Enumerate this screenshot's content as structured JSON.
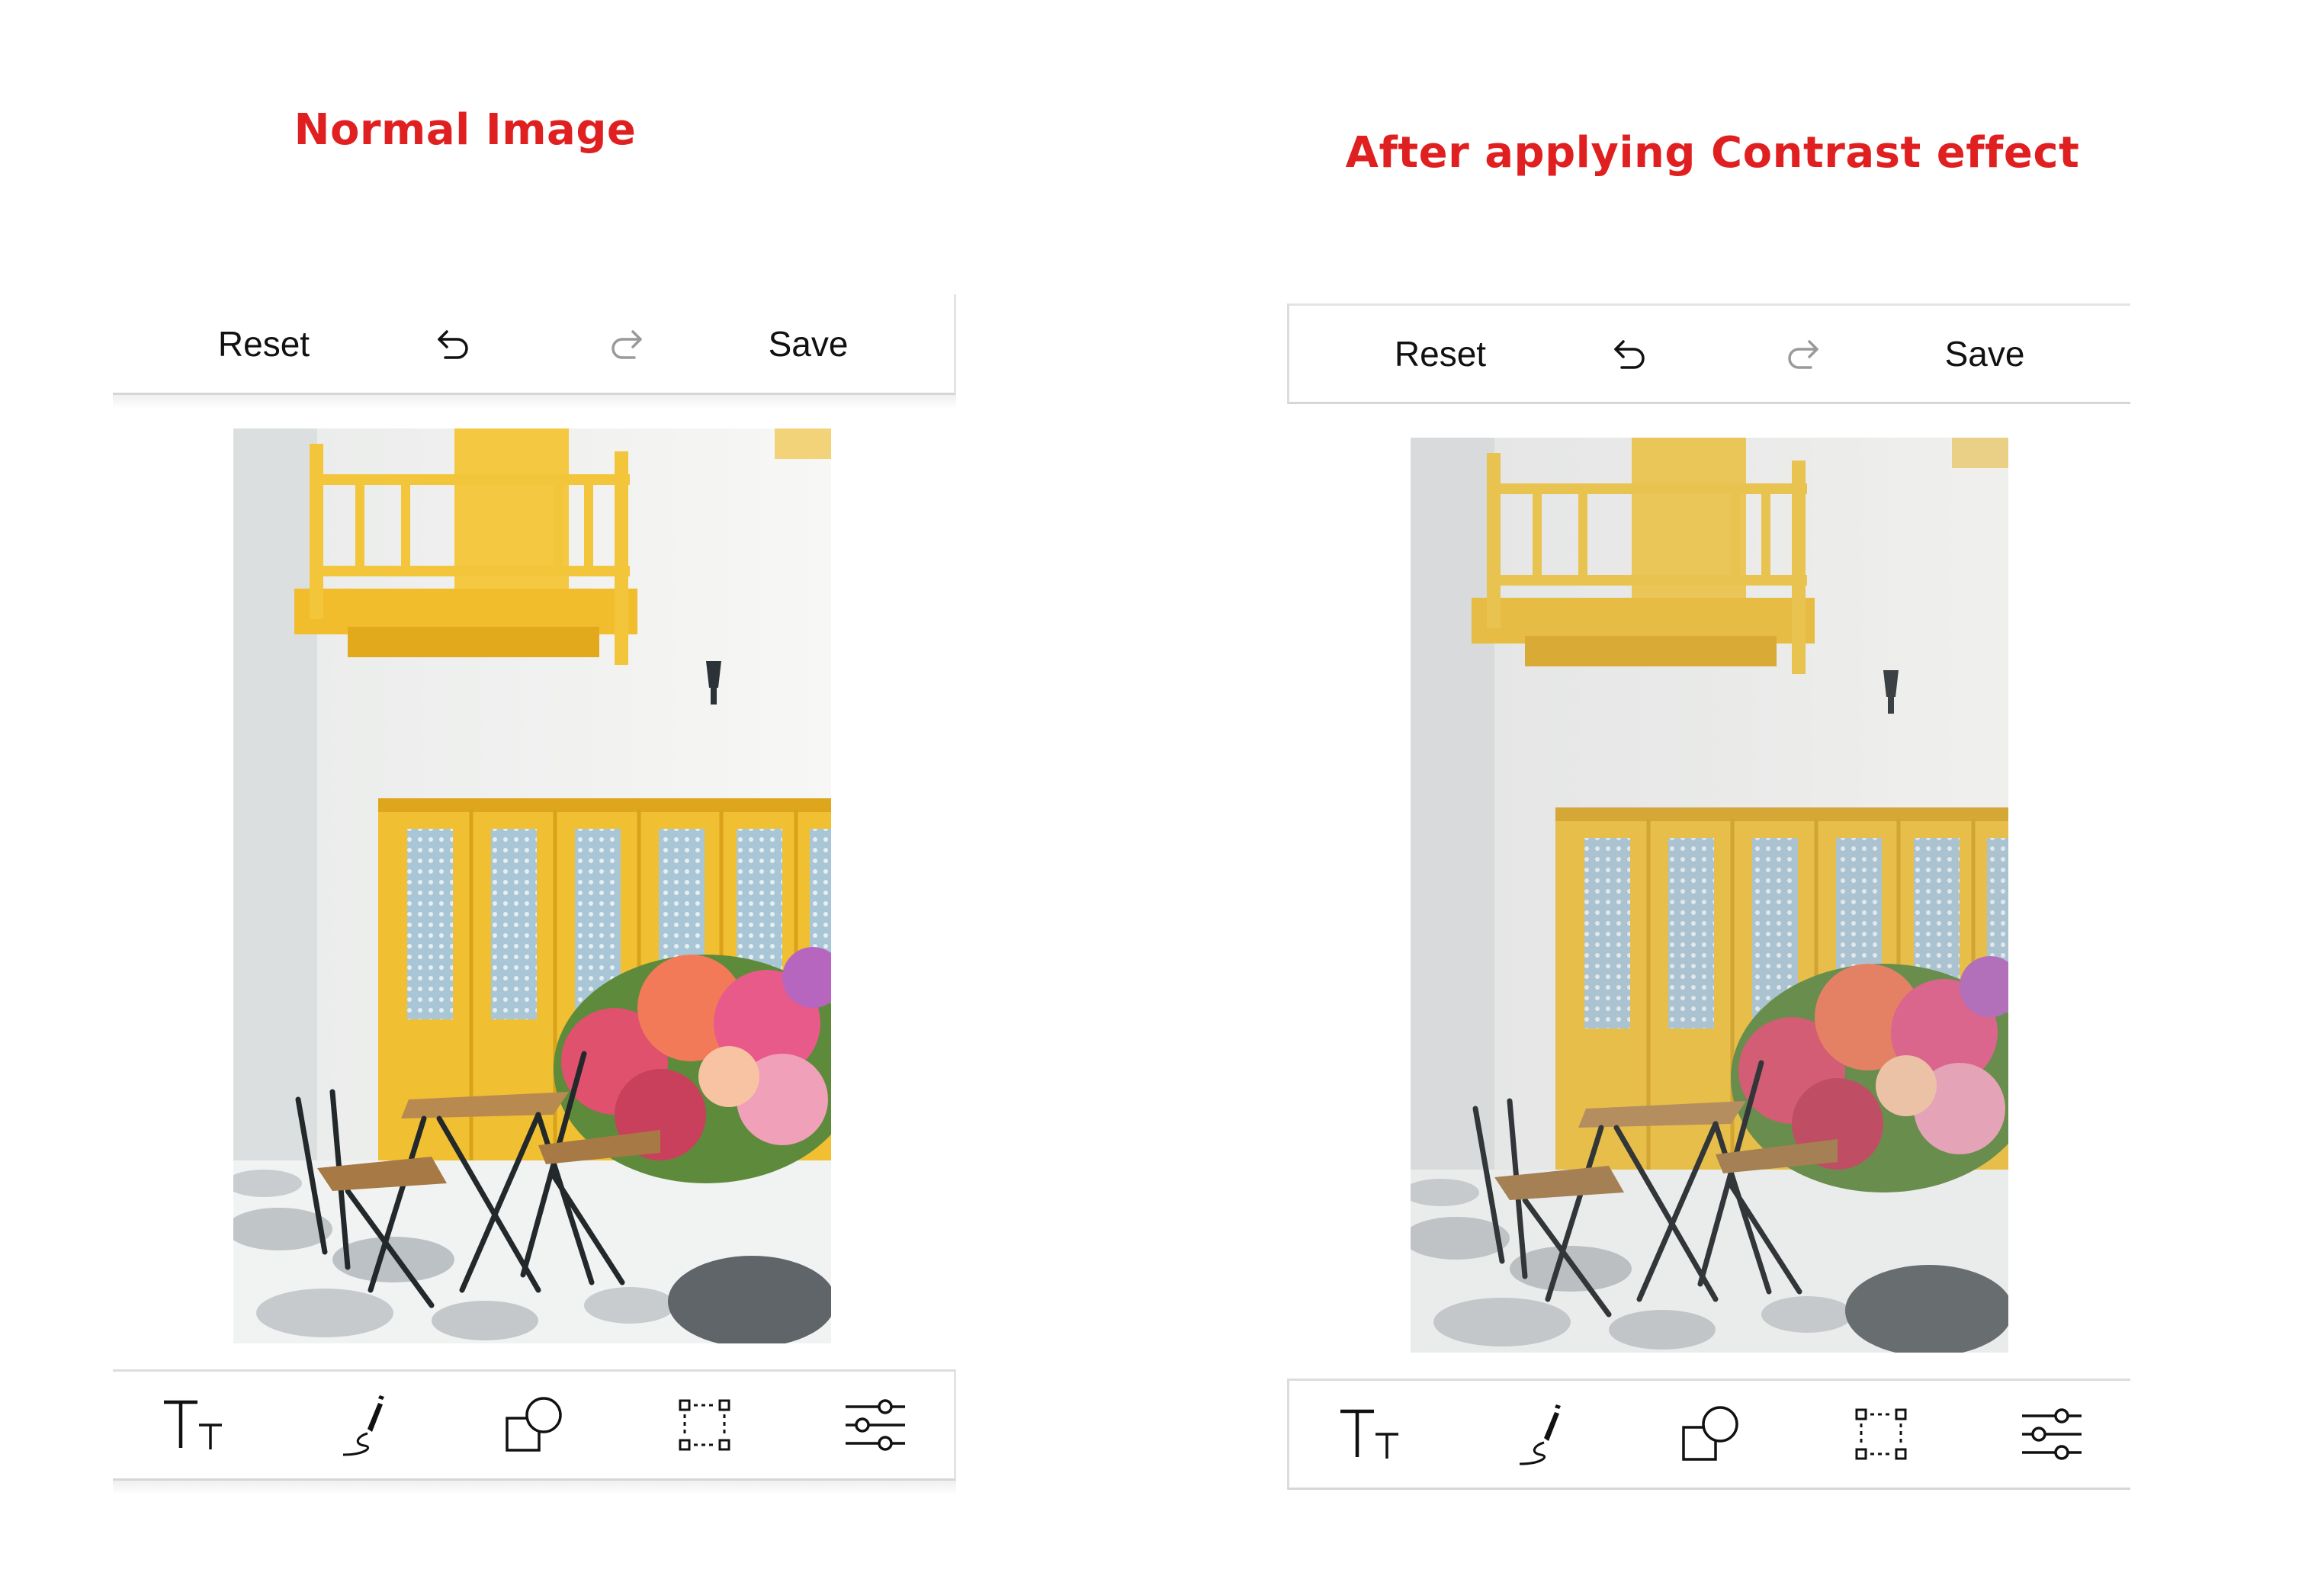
{
  "captions": {
    "left": "Normal Image",
    "right": "After applying Contrast effect"
  },
  "colors": {
    "caption": "#e02020",
    "toolbar_border": "#d6d6d6",
    "icon": "#111111",
    "disabled_icon": "#9a9a9a"
  },
  "panels": [
    {
      "name": "normal",
      "top_toolbar": {
        "reset_label": "Reset",
        "save_label": "Save",
        "undo_icon": "undo-icon",
        "redo_icon": "redo-icon"
      },
      "bottom_toolbar": [
        "text-icon",
        "freehand-draw-icon",
        "shapes-icon",
        "crop-icon",
        "adjust-filter-icon"
      ]
    },
    {
      "name": "contrast",
      "top_toolbar": {
        "reset_label": "Reset",
        "save_label": "Save",
        "undo_icon": "undo-icon",
        "redo_icon": "redo-icon"
      },
      "bottom_toolbar": [
        "text-icon",
        "freehand-draw-icon",
        "shapes-icon",
        "crop-icon",
        "adjust-filter-icon"
      ]
    }
  ]
}
